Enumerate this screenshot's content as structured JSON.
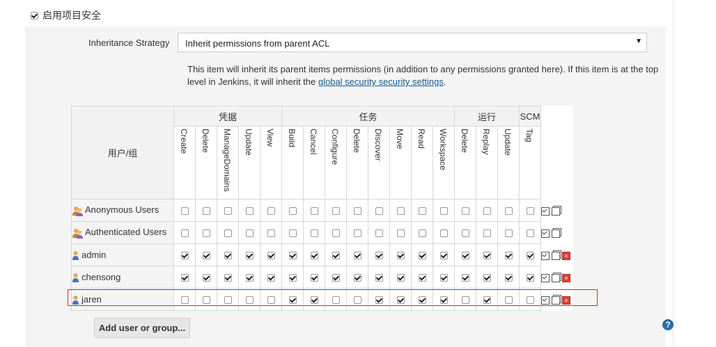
{
  "enable": {
    "label": "启用项目安全",
    "checked": true
  },
  "strategy": {
    "label": "Inheritance Strategy",
    "value": "Inherit permissions from parent ACL",
    "arrow": "▼"
  },
  "description": {
    "text_before": "This item will inherit its parent items permissions (in addition to any permissions granted here). If this item is at the top level in Jenkins, it will inherit the ",
    "link_text": "global security security settings",
    "text_after": "."
  },
  "matrix": {
    "user_header": "用户/组",
    "groups": [
      {
        "label": "凭据",
        "span": 5
      },
      {
        "label": "任务",
        "span": 8
      },
      {
        "label": "运行",
        "span": 3
      },
      {
        "label": "SCM",
        "span": 1
      }
    ],
    "permissions": [
      "Create",
      "Delete",
      "ManageDomains",
      "Update",
      "View",
      "Build",
      "Cancel",
      "Configure",
      "Delete",
      "Discover",
      "Move",
      "Read",
      "Workspace",
      "Delete",
      "Replay",
      "Update",
      "Tag"
    ],
    "rows": [
      {
        "name": "Anonymous Users",
        "type": "group",
        "deletable": false,
        "checks": [
          0,
          0,
          0,
          0,
          0,
          0,
          0,
          0,
          0,
          0,
          0,
          0,
          0,
          0,
          0,
          0,
          0
        ]
      },
      {
        "name": "Authenticated Users",
        "type": "group",
        "deletable": false,
        "checks": [
          0,
          0,
          0,
          0,
          0,
          0,
          0,
          0,
          0,
          0,
          0,
          0,
          0,
          0,
          0,
          0,
          0
        ]
      },
      {
        "name": "admin",
        "type": "user",
        "deletable": true,
        "checks": [
          1,
          1,
          1,
          1,
          1,
          1,
          1,
          1,
          1,
          1,
          1,
          1,
          1,
          1,
          1,
          1,
          1
        ]
      },
      {
        "name": "chensong",
        "type": "user",
        "deletable": true,
        "checks": [
          1,
          1,
          1,
          1,
          1,
          1,
          1,
          1,
          1,
          1,
          1,
          1,
          1,
          1,
          1,
          1,
          1
        ]
      },
      {
        "name": "jaren",
        "type": "user",
        "deletable": true,
        "checks": [
          0,
          0,
          0,
          0,
          0,
          1,
          1,
          0,
          0,
          1,
          1,
          1,
          1,
          0,
          1,
          0,
          0
        ]
      }
    ]
  },
  "add_button": {
    "label": "Add user or group..."
  },
  "help": {
    "label": "?"
  },
  "colors": {
    "highlight": "#c9302c",
    "link": "#1b5a8c",
    "delete": "#d9433b"
  }
}
